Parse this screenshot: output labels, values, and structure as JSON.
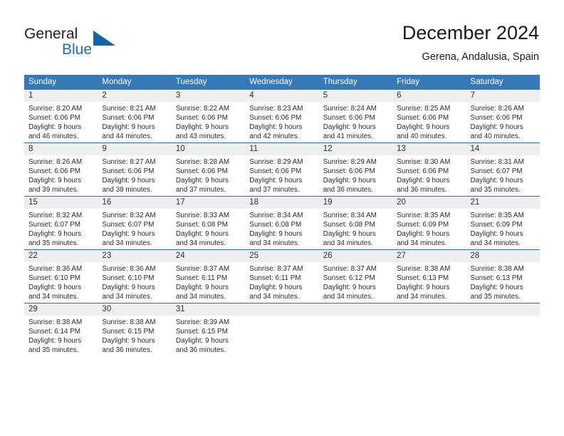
{
  "brand": {
    "word1": "General",
    "word2": "Blue",
    "logo_icon": "triangle-logo-icon",
    "accent_color": "#1064a8"
  },
  "header": {
    "title": "December 2024",
    "subtitle": "Gerena, Andalusia, Spain"
  },
  "theme": {
    "header_blue": "#3679b9",
    "row_border_blue": "#2f6fae",
    "daynum_band": "#efefef"
  },
  "weekday_headers": [
    "Sunday",
    "Monday",
    "Tuesday",
    "Wednesday",
    "Thursday",
    "Friday",
    "Saturday"
  ],
  "weeks": [
    [
      {
        "day": "1",
        "sunrise": "Sunrise: 8:20 AM",
        "sunset": "Sunset: 6:06 PM",
        "daylight1": "Daylight: 9 hours",
        "daylight2": "and 46 minutes."
      },
      {
        "day": "2",
        "sunrise": "Sunrise: 8:21 AM",
        "sunset": "Sunset: 6:06 PM",
        "daylight1": "Daylight: 9 hours",
        "daylight2": "and 44 minutes."
      },
      {
        "day": "3",
        "sunrise": "Sunrise: 8:22 AM",
        "sunset": "Sunset: 6:06 PM",
        "daylight1": "Daylight: 9 hours",
        "daylight2": "and 43 minutes."
      },
      {
        "day": "4",
        "sunrise": "Sunrise: 8:23 AM",
        "sunset": "Sunset: 6:06 PM",
        "daylight1": "Daylight: 9 hours",
        "daylight2": "and 42 minutes."
      },
      {
        "day": "5",
        "sunrise": "Sunrise: 8:24 AM",
        "sunset": "Sunset: 6:06 PM",
        "daylight1": "Daylight: 9 hours",
        "daylight2": "and 41 minutes."
      },
      {
        "day": "6",
        "sunrise": "Sunrise: 8:25 AM",
        "sunset": "Sunset: 6:06 PM",
        "daylight1": "Daylight: 9 hours",
        "daylight2": "and 40 minutes."
      },
      {
        "day": "7",
        "sunrise": "Sunrise: 8:26 AM",
        "sunset": "Sunset: 6:06 PM",
        "daylight1": "Daylight: 9 hours",
        "daylight2": "and 40 minutes."
      }
    ],
    [
      {
        "day": "8",
        "sunrise": "Sunrise: 8:26 AM",
        "sunset": "Sunset: 6:06 PM",
        "daylight1": "Daylight: 9 hours",
        "daylight2": "and 39 minutes."
      },
      {
        "day": "9",
        "sunrise": "Sunrise: 8:27 AM",
        "sunset": "Sunset: 6:06 PM",
        "daylight1": "Daylight: 9 hours",
        "daylight2": "and 38 minutes."
      },
      {
        "day": "10",
        "sunrise": "Sunrise: 8:28 AM",
        "sunset": "Sunset: 6:06 PM",
        "daylight1": "Daylight: 9 hours",
        "daylight2": "and 37 minutes."
      },
      {
        "day": "11",
        "sunrise": "Sunrise: 8:29 AM",
        "sunset": "Sunset: 6:06 PM",
        "daylight1": "Daylight: 9 hours",
        "daylight2": "and 37 minutes."
      },
      {
        "day": "12",
        "sunrise": "Sunrise: 8:29 AM",
        "sunset": "Sunset: 6:06 PM",
        "daylight1": "Daylight: 9 hours",
        "daylight2": "and 36 minutes."
      },
      {
        "day": "13",
        "sunrise": "Sunrise: 8:30 AM",
        "sunset": "Sunset: 6:06 PM",
        "daylight1": "Daylight: 9 hours",
        "daylight2": "and 36 minutes."
      },
      {
        "day": "14",
        "sunrise": "Sunrise: 8:31 AM",
        "sunset": "Sunset: 6:07 PM",
        "daylight1": "Daylight: 9 hours",
        "daylight2": "and 35 minutes."
      }
    ],
    [
      {
        "day": "15",
        "sunrise": "Sunrise: 8:32 AM",
        "sunset": "Sunset: 6:07 PM",
        "daylight1": "Daylight: 9 hours",
        "daylight2": "and 35 minutes."
      },
      {
        "day": "16",
        "sunrise": "Sunrise: 8:32 AM",
        "sunset": "Sunset: 6:07 PM",
        "daylight1": "Daylight: 9 hours",
        "daylight2": "and 34 minutes."
      },
      {
        "day": "17",
        "sunrise": "Sunrise: 8:33 AM",
        "sunset": "Sunset: 6:08 PM",
        "daylight1": "Daylight: 9 hours",
        "daylight2": "and 34 minutes."
      },
      {
        "day": "18",
        "sunrise": "Sunrise: 8:34 AM",
        "sunset": "Sunset: 6:08 PM",
        "daylight1": "Daylight: 9 hours",
        "daylight2": "and 34 minutes."
      },
      {
        "day": "19",
        "sunrise": "Sunrise: 8:34 AM",
        "sunset": "Sunset: 6:08 PM",
        "daylight1": "Daylight: 9 hours",
        "daylight2": "and 34 minutes."
      },
      {
        "day": "20",
        "sunrise": "Sunrise: 8:35 AM",
        "sunset": "Sunset: 6:09 PM",
        "daylight1": "Daylight: 9 hours",
        "daylight2": "and 34 minutes."
      },
      {
        "day": "21",
        "sunrise": "Sunrise: 8:35 AM",
        "sunset": "Sunset: 6:09 PM",
        "daylight1": "Daylight: 9 hours",
        "daylight2": "and 34 minutes."
      }
    ],
    [
      {
        "day": "22",
        "sunrise": "Sunrise: 8:36 AM",
        "sunset": "Sunset: 6:10 PM",
        "daylight1": "Daylight: 9 hours",
        "daylight2": "and 34 minutes."
      },
      {
        "day": "23",
        "sunrise": "Sunrise: 8:36 AM",
        "sunset": "Sunset: 6:10 PM",
        "daylight1": "Daylight: 9 hours",
        "daylight2": "and 34 minutes."
      },
      {
        "day": "24",
        "sunrise": "Sunrise: 8:37 AM",
        "sunset": "Sunset: 6:11 PM",
        "daylight1": "Daylight: 9 hours",
        "daylight2": "and 34 minutes."
      },
      {
        "day": "25",
        "sunrise": "Sunrise: 8:37 AM",
        "sunset": "Sunset: 6:11 PM",
        "daylight1": "Daylight: 9 hours",
        "daylight2": "and 34 minutes."
      },
      {
        "day": "26",
        "sunrise": "Sunrise: 8:37 AM",
        "sunset": "Sunset: 6:12 PM",
        "daylight1": "Daylight: 9 hours",
        "daylight2": "and 34 minutes."
      },
      {
        "day": "27",
        "sunrise": "Sunrise: 8:38 AM",
        "sunset": "Sunset: 6:13 PM",
        "daylight1": "Daylight: 9 hours",
        "daylight2": "and 34 minutes."
      },
      {
        "day": "28",
        "sunrise": "Sunrise: 8:38 AM",
        "sunset": "Sunset: 6:13 PM",
        "daylight1": "Daylight: 9 hours",
        "daylight2": "and 35 minutes."
      }
    ],
    [
      {
        "day": "29",
        "sunrise": "Sunrise: 8:38 AM",
        "sunset": "Sunset: 6:14 PM",
        "daylight1": "Daylight: 9 hours",
        "daylight2": "and 35 minutes."
      },
      {
        "day": "30",
        "sunrise": "Sunrise: 8:38 AM",
        "sunset": "Sunset: 6:15 PM",
        "daylight1": "Daylight: 9 hours",
        "daylight2": "and 36 minutes."
      },
      {
        "day": "31",
        "sunrise": "Sunrise: 8:39 AM",
        "sunset": "Sunset: 6:15 PM",
        "daylight1": "Daylight: 9 hours",
        "daylight2": "and 36 minutes."
      },
      {
        "day": "",
        "sunrise": "",
        "sunset": "",
        "daylight1": "",
        "daylight2": ""
      },
      {
        "day": "",
        "sunrise": "",
        "sunset": "",
        "daylight1": "",
        "daylight2": ""
      },
      {
        "day": "",
        "sunrise": "",
        "sunset": "",
        "daylight1": "",
        "daylight2": ""
      },
      {
        "day": "",
        "sunrise": "",
        "sunset": "",
        "daylight1": "",
        "daylight2": ""
      }
    ]
  ]
}
